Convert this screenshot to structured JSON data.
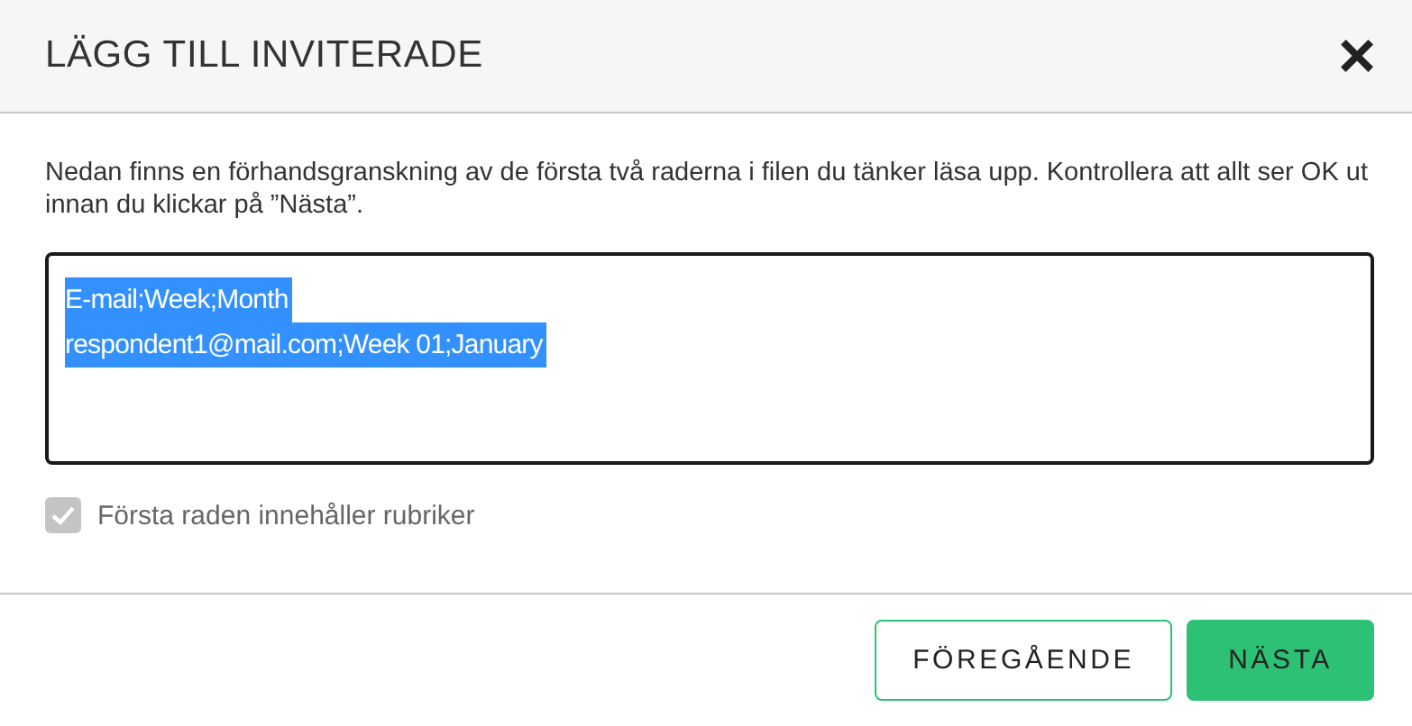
{
  "dialog": {
    "title": "LÄGG TILL INVITERADE",
    "close": "×"
  },
  "intro": "Nedan finns en förhandsgranskning av de första två raderna i filen du tänker läsa upp. Kontrollera att allt ser OK ut innan du klickar på ”Nästa”.",
  "preview": {
    "selected": true,
    "lines": [
      "E-mail;Week;Month",
      "respondent1@mail.com;Week 01;January"
    ]
  },
  "header_checkbox": {
    "label": "Första raden innehåller rubriker",
    "checked": true,
    "disabled": true
  },
  "buttons": [
    {
      "label": "FÖREGÅENDE",
      "kind": "secondary"
    },
    {
      "label": "NÄSTA",
      "kind": "primary"
    }
  ]
}
